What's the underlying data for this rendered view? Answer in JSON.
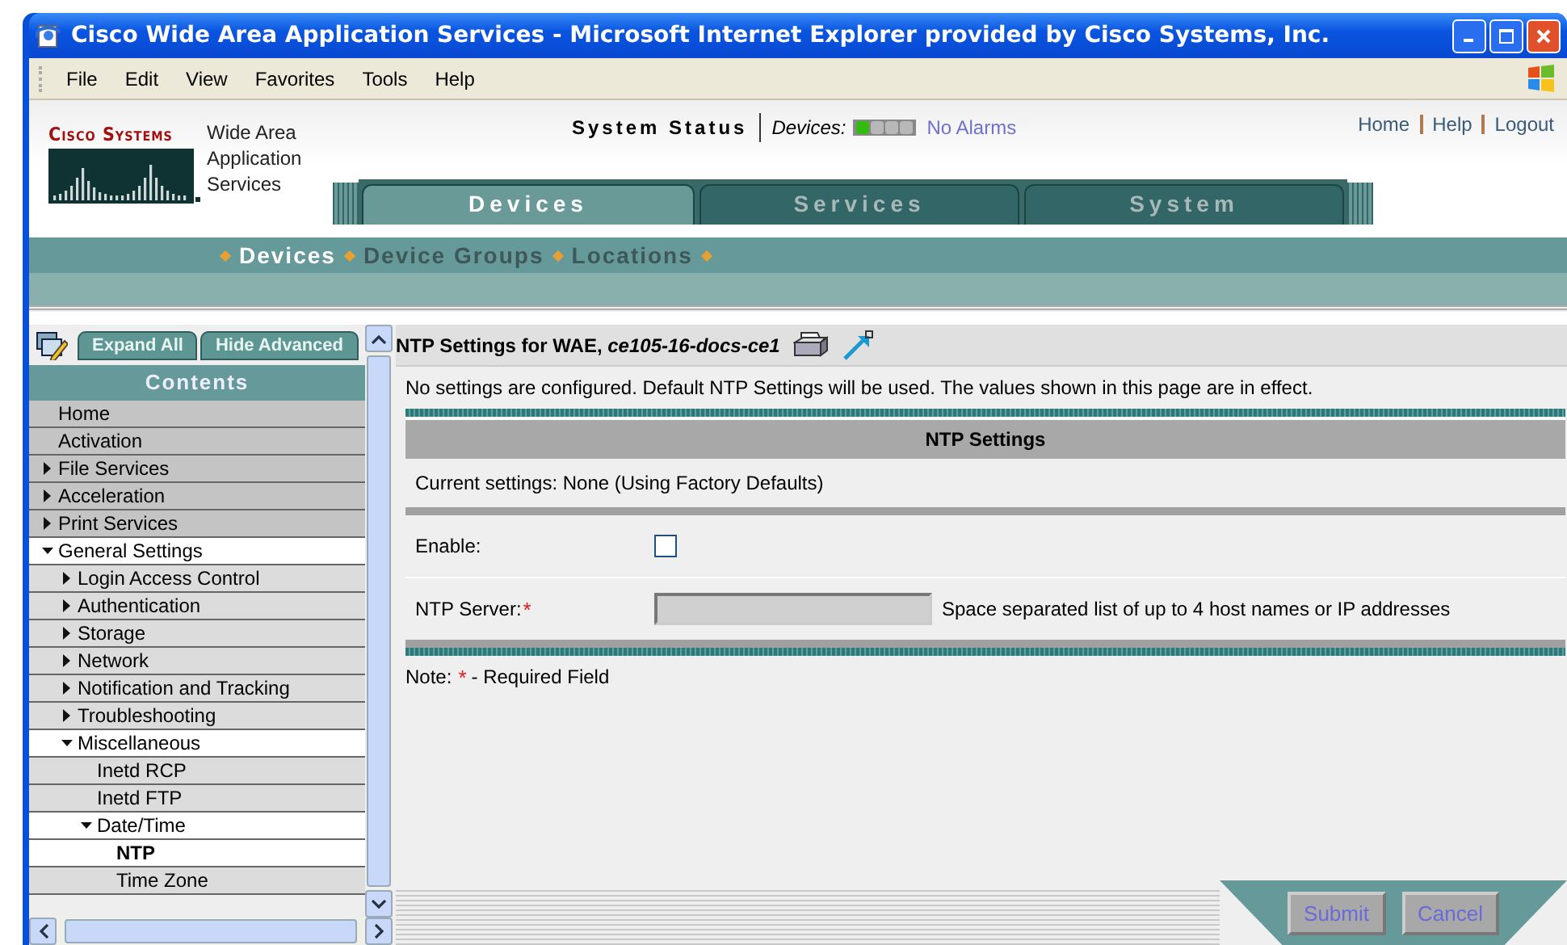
{
  "window": {
    "title": "Cisco Wide Area Application Services - Microsoft Internet Explorer provided by Cisco Systems, Inc."
  },
  "menu": [
    "File",
    "Edit",
    "View",
    "Favorites",
    "Tools",
    "Help"
  ],
  "logo": {
    "text": "Cisco Systems"
  },
  "product_name": "Wide Area Application Services",
  "system_status": {
    "label": "System Status",
    "devices_label": "Devices:",
    "lights": [
      {
        "color": "#33bb11"
      },
      {
        "color": "#b8b8b8"
      },
      {
        "color": "#b8b8b8"
      },
      {
        "color": "#b8b8b8"
      }
    ],
    "alarms": "No Alarms"
  },
  "top_links": [
    "Home",
    "Help",
    "Logout"
  ],
  "tabs": [
    {
      "label": "Devices",
      "selected": true
    },
    {
      "label": "Services",
      "selected": false
    },
    {
      "label": "System",
      "selected": false
    }
  ],
  "subnav": [
    {
      "label": "Devices",
      "selected": true
    },
    {
      "label": "Device Groups",
      "selected": false
    },
    {
      "label": "Locations",
      "selected": false
    }
  ],
  "sidebar": {
    "buttons": [
      "Expand All",
      "Hide Advanced"
    ],
    "heading": "Contents",
    "items": [
      {
        "label": "Home",
        "kind": "leaf",
        "selected": false
      },
      {
        "label": "Activation",
        "kind": "leaf",
        "selected": false
      },
      {
        "label": "File Services",
        "kind": "folder",
        "expanded": false,
        "selected": false
      },
      {
        "label": "Acceleration",
        "kind": "folder",
        "expanded": false,
        "selected": false
      },
      {
        "label": "Print Services",
        "kind": "folder",
        "expanded": false,
        "selected": false
      },
      {
        "label": "General Settings",
        "kind": "folder",
        "expanded": true,
        "selected": false,
        "children": [
          {
            "label": "Login Access Control",
            "kind": "folder",
            "expanded": false,
            "selected": false
          },
          {
            "label": "Authentication",
            "kind": "folder",
            "expanded": false,
            "selected": false
          },
          {
            "label": "Storage",
            "kind": "folder",
            "expanded": false,
            "selected": false
          },
          {
            "label": "Network",
            "kind": "folder",
            "expanded": false,
            "selected": false
          },
          {
            "label": "Notification and Tracking",
            "kind": "folder",
            "expanded": false,
            "selected": false
          },
          {
            "label": "Troubleshooting",
            "kind": "folder",
            "expanded": false,
            "selected": false
          },
          {
            "label": "Miscellaneous",
            "kind": "folder",
            "expanded": true,
            "selected": false,
            "children": [
              {
                "label": "Inetd RCP",
                "kind": "leaf",
                "selected": false
              },
              {
                "label": "Inetd FTP",
                "kind": "leaf",
                "selected": false
              },
              {
                "label": "Date/Time",
                "kind": "folder",
                "expanded": true,
                "selected": false,
                "children": [
                  {
                    "label": "NTP",
                    "kind": "leaf",
                    "selected": true
                  },
                  {
                    "label": "Time Zone",
                    "kind": "leaf",
                    "selected": false
                  }
                ]
              }
            ]
          }
        ]
      }
    ]
  },
  "page": {
    "title": "NTP Settings for WAE, *ce105-16-docs-ce1*",
    "notice": "No settings are configured. Default NTP Settings will be used. The values shown in this page are in effect."
  },
  "section": {
    "title": "NTP Settings",
    "current": "Current settings: None (Using Factory Defaults)",
    "fields": [
      {
        "kind": "checkbox",
        "label": "Enable:",
        "checked": false
      },
      {
        "kind": "text",
        "label": "NTP Server:",
        "required_mark": "*",
        "disabled": true,
        "hint": "Space separated list of up to 4 host names or IP addresses"
      }
    ]
  },
  "note": {
    "prefix": "Note:",
    "mark": "*",
    "text": "- Required Field"
  },
  "actions": [
    "Submit",
    "Cancel"
  ]
}
